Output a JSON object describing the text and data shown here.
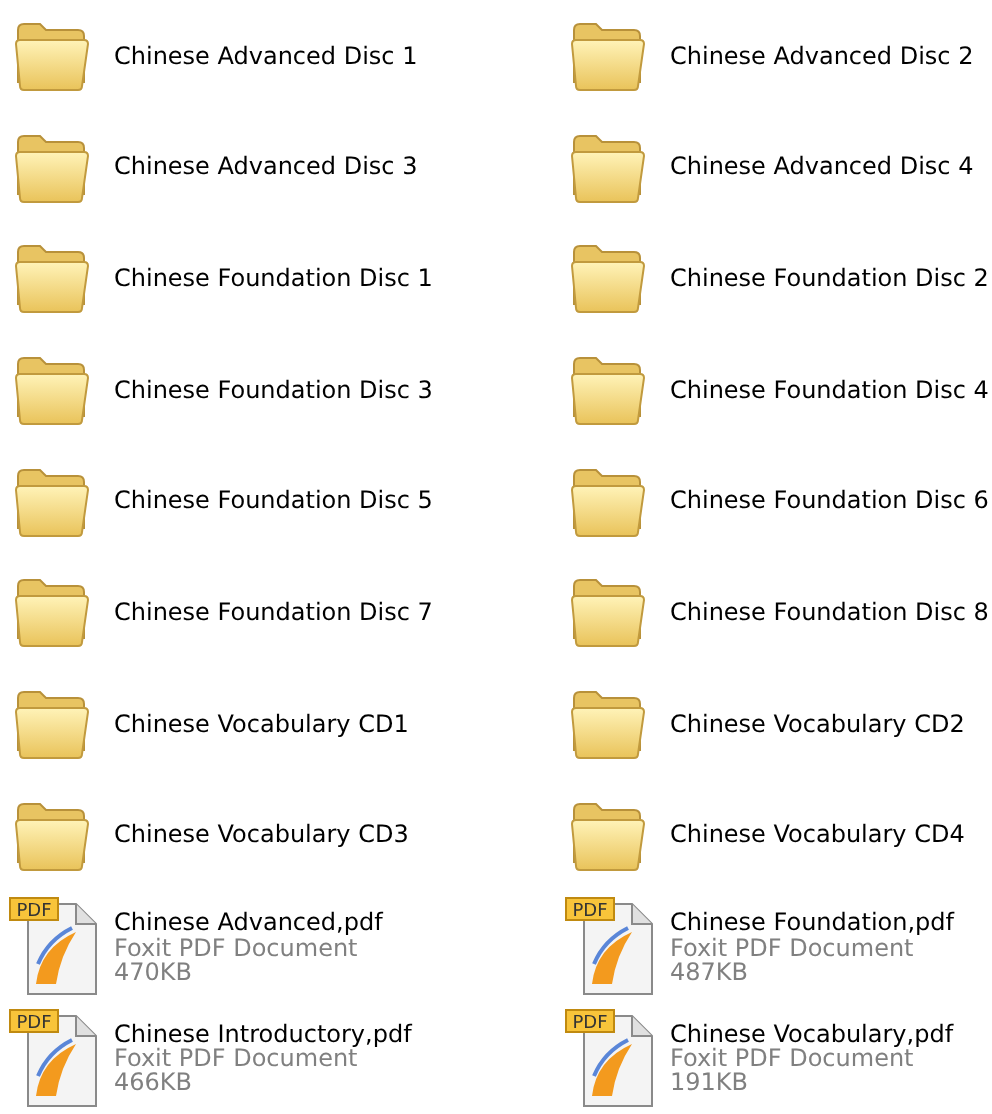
{
  "items": [
    {
      "kind": "folder",
      "name": "Chinese Advanced Disc 1"
    },
    {
      "kind": "folder",
      "name": "Chinese Advanced Disc 2"
    },
    {
      "kind": "folder",
      "name": "Chinese Advanced Disc 3"
    },
    {
      "kind": "folder",
      "name": "Chinese Advanced Disc 4"
    },
    {
      "kind": "folder",
      "name": "Chinese Foundation Disc 1"
    },
    {
      "kind": "folder",
      "name": "Chinese Foundation Disc 2"
    },
    {
      "kind": "folder",
      "name": "Chinese Foundation Disc 3"
    },
    {
      "kind": "folder",
      "name": "Chinese Foundation Disc 4"
    },
    {
      "kind": "folder",
      "name": "Chinese Foundation Disc 5"
    },
    {
      "kind": "folder",
      "name": "Chinese Foundation Disc 6"
    },
    {
      "kind": "folder",
      "name": "Chinese Foundation Disc 7"
    },
    {
      "kind": "folder",
      "name": "Chinese Foundation Disc 8"
    },
    {
      "kind": "folder",
      "name": "Chinese Vocabulary CD1"
    },
    {
      "kind": "folder",
      "name": "Chinese Vocabulary CD2"
    },
    {
      "kind": "folder",
      "name": "Chinese Vocabulary CD3"
    },
    {
      "kind": "folder",
      "name": "Chinese Vocabulary CD4"
    },
    {
      "kind": "pdf",
      "name": "Chinese Advanced,pdf",
      "type": "Foxit PDF Document",
      "size": "470KB",
      "badge": "PDF"
    },
    {
      "kind": "pdf",
      "name": "Chinese Foundation,pdf",
      "type": "Foxit PDF Document",
      "size": "487KB",
      "badge": "PDF"
    },
    {
      "kind": "pdf",
      "name": "Chinese Introductory,pdf",
      "type": "Foxit PDF Document",
      "size": "466KB",
      "badge": "PDF"
    },
    {
      "kind": "pdf",
      "name": "Chinese Vocabulary,pdf",
      "type": "Foxit PDF Document",
      "size": "191KB",
      "badge": "PDF"
    }
  ]
}
